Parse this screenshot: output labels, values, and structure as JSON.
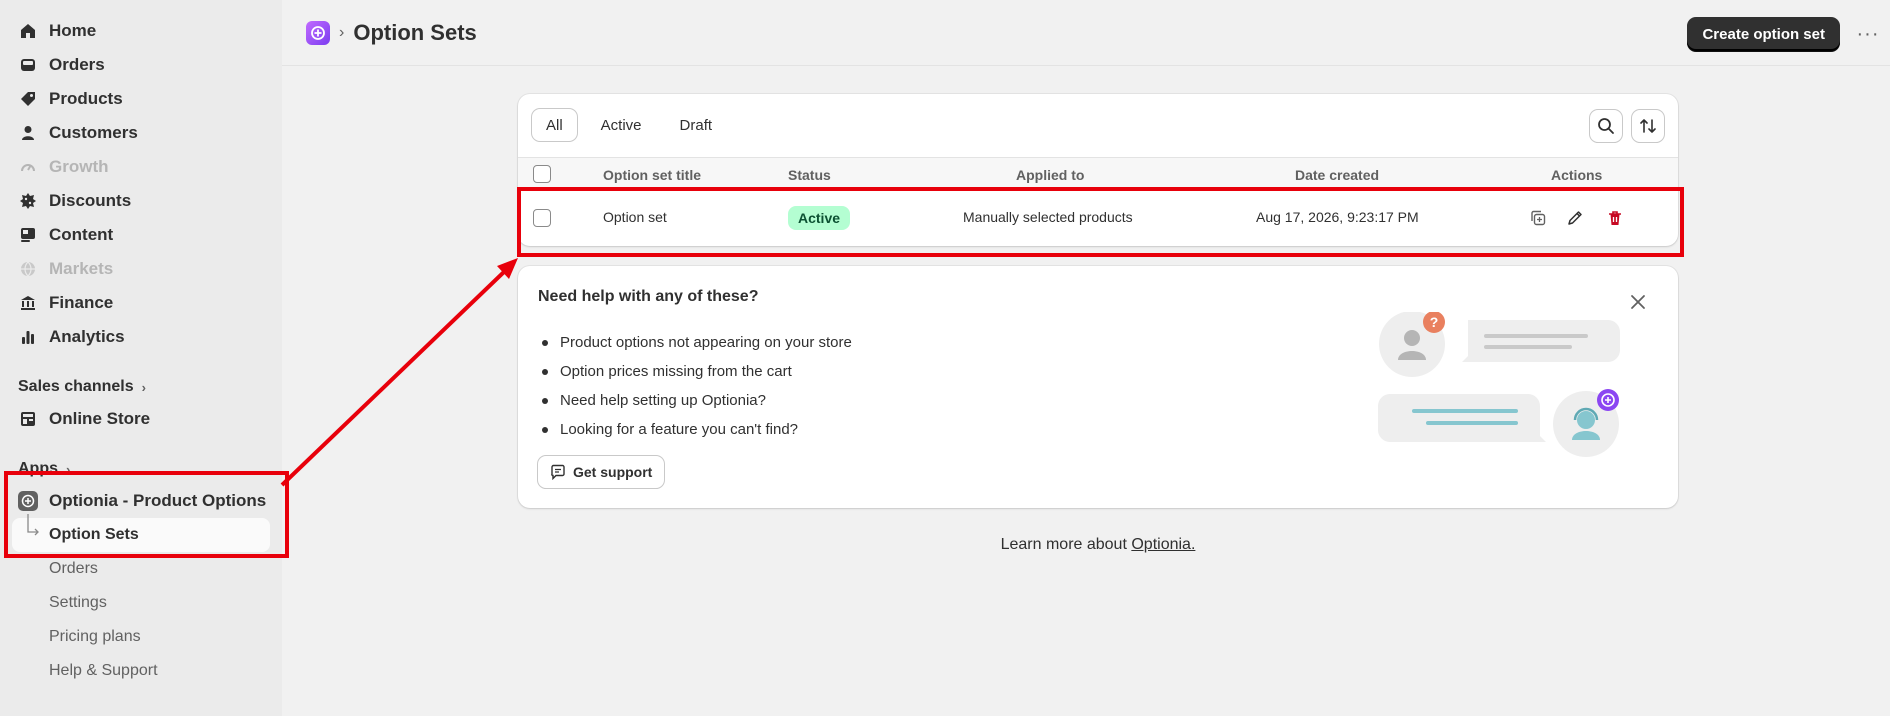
{
  "sidebar": {
    "items": [
      {
        "label": "Home",
        "icon": "home-icon",
        "disabled": false
      },
      {
        "label": "Orders",
        "icon": "inbox-icon",
        "disabled": false
      },
      {
        "label": "Products",
        "icon": "tag-icon",
        "disabled": false
      },
      {
        "label": "Customers",
        "icon": "person-icon",
        "disabled": false
      },
      {
        "label": "Growth",
        "icon": "gauge-icon",
        "disabled": true
      },
      {
        "label": "Discounts",
        "icon": "discount-icon",
        "disabled": false
      },
      {
        "label": "Content",
        "icon": "content-icon",
        "disabled": false
      },
      {
        "label": "Markets",
        "icon": "globe-icon",
        "disabled": true
      },
      {
        "label": "Finance",
        "icon": "bank-icon",
        "disabled": false
      },
      {
        "label": "Analytics",
        "icon": "bar-chart-icon",
        "disabled": false
      }
    ],
    "sales_channels_label": "Sales channels",
    "online_store_label": "Online Store",
    "apps_label": "Apps",
    "app_name": "Optionia - Product Options",
    "app_subitems": [
      "Option Sets",
      "Orders",
      "Settings",
      "Pricing plans",
      "Help & Support"
    ]
  },
  "header": {
    "breadcrumb_sep": "›",
    "title": "Option Sets",
    "create_label": "Create option set",
    "more_label": "···"
  },
  "table": {
    "tabs": [
      "All",
      "Active",
      "Draft"
    ],
    "columns": [
      "Option set title",
      "Status",
      "Applied to",
      "Date created",
      "Actions"
    ],
    "rows": [
      {
        "title": "Option set",
        "status": "Active",
        "applied_to": "Manually selected products",
        "date_created": "Aug 17, 2026, 9:23:17 PM"
      }
    ]
  },
  "help": {
    "title": "Need help with any of these?",
    "items": [
      "Product options not appearing on your store",
      "Option prices missing from the cart",
      "Need help setting up Optionia?",
      "Looking for a feature you can't find?"
    ],
    "support_label": "Get support",
    "question_mark": "?"
  },
  "footer": {
    "learn_prefix": "Learn more about ",
    "learn_link": "Optionia."
  },
  "colors": {
    "accent_purple": "#8b46f2",
    "badge_bg": "#b4fed2",
    "badge_text": "#0c5132",
    "delete_red": "#c70a24",
    "annotation_red": "#e8000b"
  }
}
